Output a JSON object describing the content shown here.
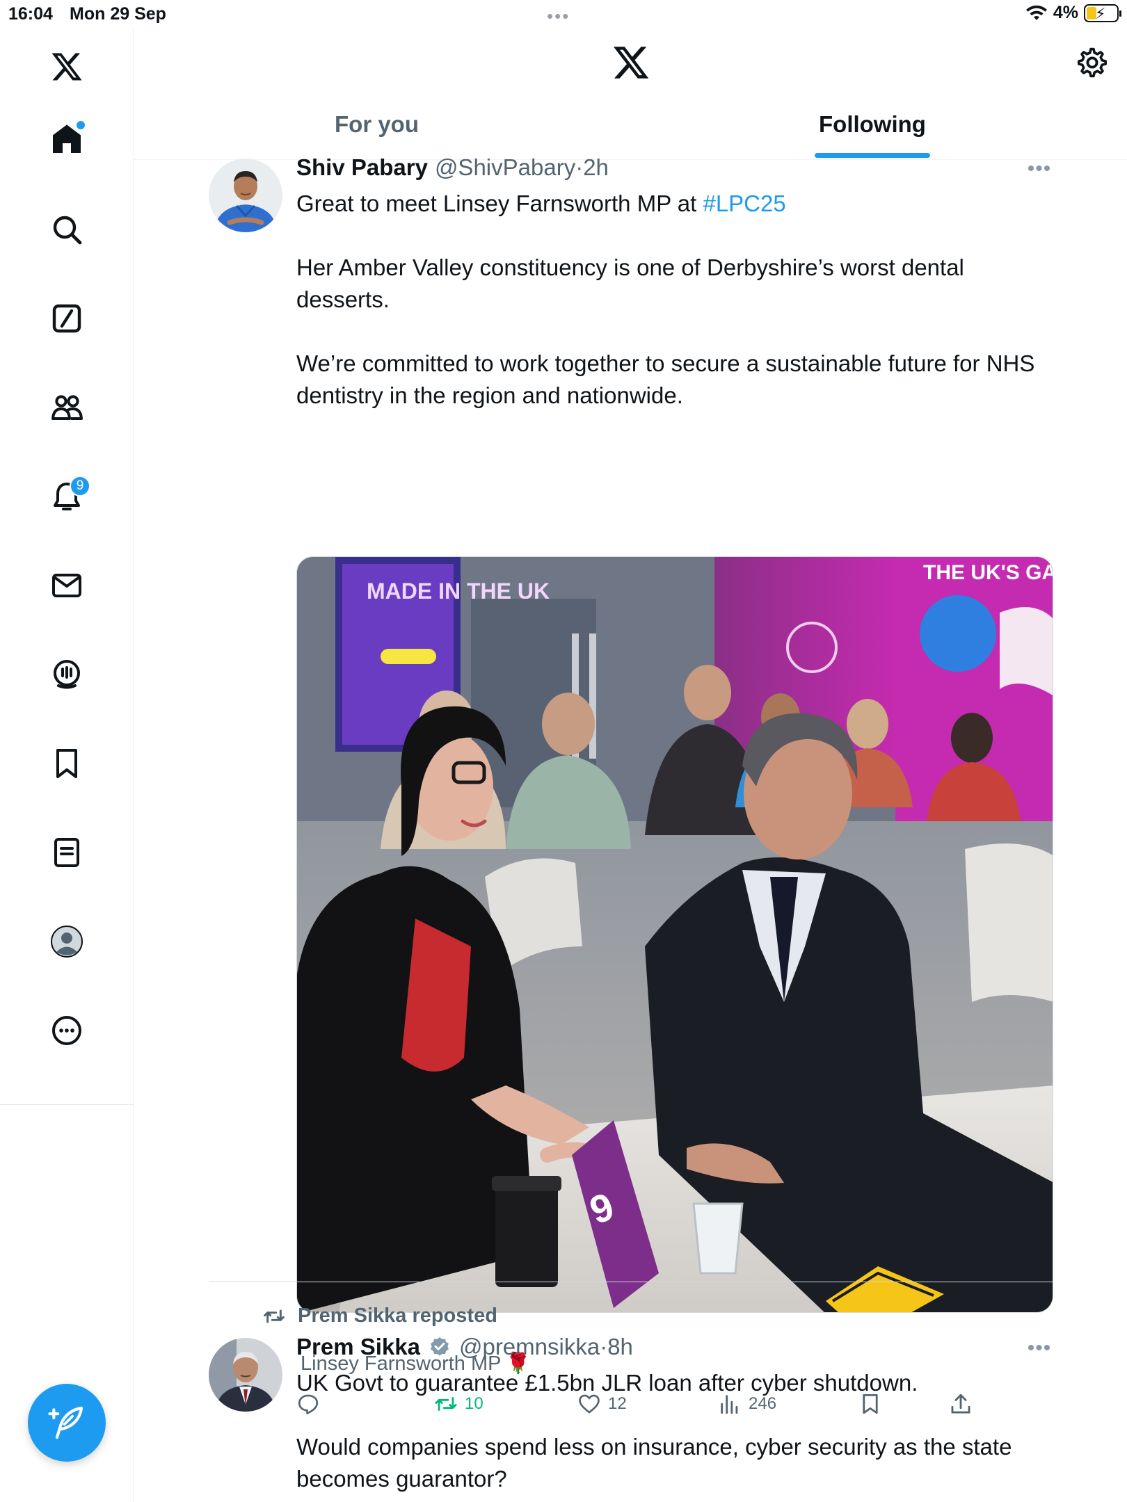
{
  "status_bar": {
    "time": "16:04",
    "date": "Mon 29 Sep",
    "battery_percent": "4%",
    "icons": [
      "wifi-icon",
      "battery-charging-icon"
    ]
  },
  "rail": {
    "items": [
      {
        "name": "x-logo-icon"
      },
      {
        "name": "home-icon",
        "has_dot": true
      },
      {
        "name": "search-icon"
      },
      {
        "name": "grok-icon"
      },
      {
        "name": "communities-icon"
      },
      {
        "name": "notifications-icon",
        "badge": "9"
      },
      {
        "name": "messages-icon"
      },
      {
        "name": "spaces-icon"
      },
      {
        "name": "bookmarks-icon"
      },
      {
        "name": "lists-icon"
      },
      {
        "name": "profile-icon"
      },
      {
        "name": "more-icon"
      }
    ],
    "compose_icon": "compose-icon"
  },
  "header": {
    "logo": "x-logo-icon",
    "settings_icon": "settings-icon",
    "tabs": [
      {
        "label": "For you",
        "active": false
      },
      {
        "label": "Following",
        "active": true
      }
    ]
  },
  "feed": {
    "tweets": [
      {
        "display_name": "Shiv Pabary",
        "handle": "@ShivPabary",
        "time": "·2h",
        "text_line1_prefix": "Great to meet Linsey Farnsworth MP at ",
        "hashtag": "#LPC25",
        "paragraph2": "Her Amber Valley constituency is one of Derbyshire’s worst dental desserts.",
        "paragraph3": "We’re committed to work together to secure a sustainable future for NHS dentistry in the region and nationwide.",
        "tagged": "Linsey Farnsworth MP",
        "tagged_emoji": "🌹",
        "image_signs": {
          "made_in_uk": "MADE IN THE UK",
          "uks": "THE UK'S GA",
          "table_number": "9"
        },
        "actions": {
          "reply_count": "",
          "retweet_count": "10",
          "like_count": "12",
          "views_count": "246"
        }
      },
      {
        "repost_label": "Prem Sikka reposted",
        "display_name": "Prem Sikka",
        "verified": true,
        "handle": "@premnsikka",
        "time": "·8h",
        "paragraph1": "UK Govt to guarantee £1.5bn JLR loan after cyber shutdown.",
        "paragraph2": "Would companies spend less on insurance, cyber security as the state becomes guarantor?"
      }
    ]
  },
  "colors": {
    "accent": "#1d9bf0",
    "text": "#0f1419",
    "secondary_text": "#536471",
    "retweet_green": "#00ba7c",
    "border": "#eff3f4"
  }
}
